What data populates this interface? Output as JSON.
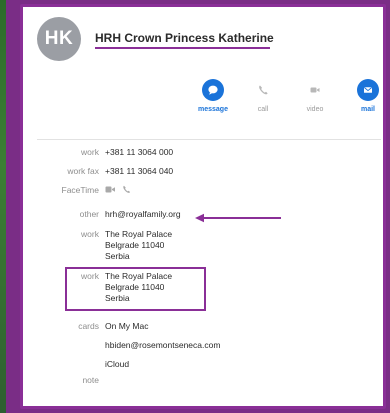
{
  "contact": {
    "initials": "HK",
    "name": "HRH Crown Princess Katherine"
  },
  "actions": [
    {
      "label": "message",
      "icon": "message-icon",
      "active": true
    },
    {
      "label": "call",
      "icon": "phone-icon",
      "active": false
    },
    {
      "label": "video",
      "icon": "video-icon",
      "active": false
    },
    {
      "label": "mail",
      "icon": "mail-icon",
      "active": true
    }
  ],
  "fields": {
    "work_phone": {
      "label": "work",
      "value": "+381 11 3064 000"
    },
    "work_fax": {
      "label": "work fax",
      "value": "+381 11 3064 040"
    },
    "facetime": {
      "label": "FaceTime"
    },
    "other_email": {
      "label": "other",
      "value": "hrh@royalfamily.org"
    },
    "work_address_1": {
      "label": "work",
      "line1": "The Royal Palace",
      "line2": "Belgrade 11040",
      "line3": "Serbia"
    },
    "work_address_2": {
      "label": "work",
      "line1": "The Royal Palace",
      "line2": "Belgrade 11040",
      "line3": "Serbia"
    },
    "cards": {
      "label": "cards",
      "line1": "On My Mac",
      "line2": "hbiden@rosemontseneca.com",
      "line3": "iCloud"
    },
    "note": {
      "label": "note"
    }
  },
  "colors": {
    "accent": "#1a73d9",
    "annotation": "#8a2f97",
    "avatar": "#9b9ea4"
  }
}
